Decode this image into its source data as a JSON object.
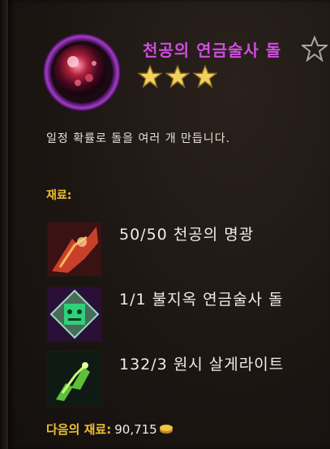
{
  "recipe": {
    "title": "천공의 연금술사 돌",
    "rating": 3,
    "description": "일정 확률로 돌을 여러 개 만듭니다."
  },
  "materials": {
    "header": "재료:",
    "items": [
      {
        "count": "50/50",
        "name": "천공의 명광",
        "icon": "celestial-light-icon"
      },
      {
        "count": "1/1",
        "name": "불지옥 연금술사 돌",
        "icon": "hellfire-alchemist-stone-icon"
      },
      {
        "count": "132/3",
        "name": "원시 살게라이트",
        "icon": "primal-sargerite-icon"
      }
    ]
  },
  "footer": {
    "label": "다음의 재료:",
    "value": "90,715"
  },
  "colors": {
    "title": "#d14de0",
    "header": "#f0c030",
    "text": "#f1ece4"
  }
}
